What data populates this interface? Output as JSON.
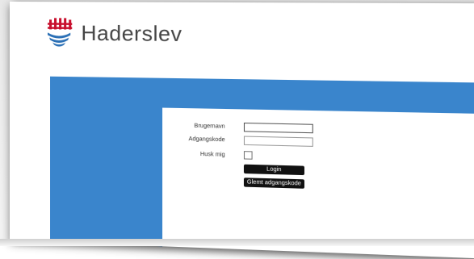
{
  "header": {
    "brand": "Haderslev",
    "logo_icon": "haderslev-crest-icon"
  },
  "colors": {
    "banner": "#3a85cc",
    "button": "#111111",
    "logo_red": "#c8102e",
    "logo_blue": "#2a6fb5"
  },
  "login": {
    "username_label": "Brugernavn",
    "username_value": "",
    "password_label": "Adgangskode",
    "password_value": "",
    "remember_label": "Husk mig",
    "remember_checked": false,
    "login_button": "Login",
    "forgot_button": "Glemt adgangskode"
  }
}
